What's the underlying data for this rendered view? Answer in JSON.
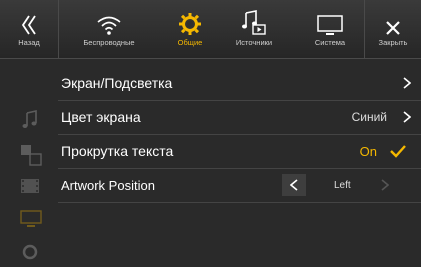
{
  "nav": {
    "back_label": "Назад",
    "wireless_label": "Беспроводные",
    "general_label": "Общие",
    "sources_label": "Источники",
    "system_label": "Система",
    "close_label": "Закрыть"
  },
  "menu": {
    "items": [
      {
        "label": "Экран/Подсветка",
        "value": ""
      },
      {
        "label": "Цвет экрана",
        "value": "Синий"
      },
      {
        "label": "Прокрутка текста",
        "value": "On"
      },
      {
        "label": "Artwork Position",
        "value": "Left"
      }
    ]
  },
  "colors": {
    "accent": "#f5b800",
    "background": "#2a2a2a"
  }
}
